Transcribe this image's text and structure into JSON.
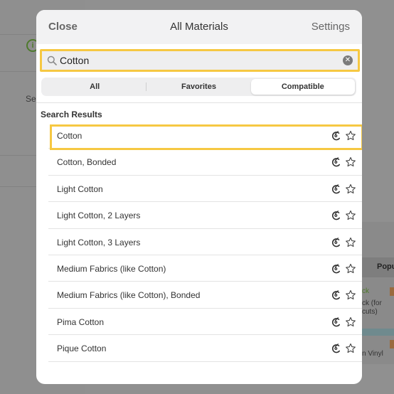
{
  "background": {
    "info_icon": "info-circle-icon",
    "partial_label": "Se",
    "tab_partial": "Popu",
    "card_text_1": "ck",
    "card_text_2": "ck (for",
    "card_text_3": "cuts)",
    "card_text_4": "n Vinyl"
  },
  "nav": {
    "close_label": "Close",
    "title": "All Materials",
    "settings_label": "Settings"
  },
  "search": {
    "value": "Cotton",
    "icon": "search-icon",
    "clear_icon": "clear-icon"
  },
  "tabs": [
    {
      "label": "All",
      "active": false
    },
    {
      "label": "Favorites",
      "active": false
    },
    {
      "label": "Compatible",
      "active": true
    }
  ],
  "results": {
    "heading": "Search Results",
    "items": [
      {
        "label": "Cotton",
        "highlighted": true
      },
      {
        "label": "Cotton, Bonded"
      },
      {
        "label": "Light Cotton"
      },
      {
        "label": "Light Cotton, 2 Layers"
      },
      {
        "label": "Light Cotton, 3 Layers"
      },
      {
        "label": "Medium Fabrics (like Cotton)"
      },
      {
        "label": "Medium Fabrics (like Cotton), Bonded"
      },
      {
        "label": "Pima Cotton"
      },
      {
        "label": "Pique Cotton"
      }
    ]
  },
  "colors": {
    "highlight": "#f6c842",
    "nav_bg": "#f2f2f3",
    "dim_bg": "#909090"
  }
}
